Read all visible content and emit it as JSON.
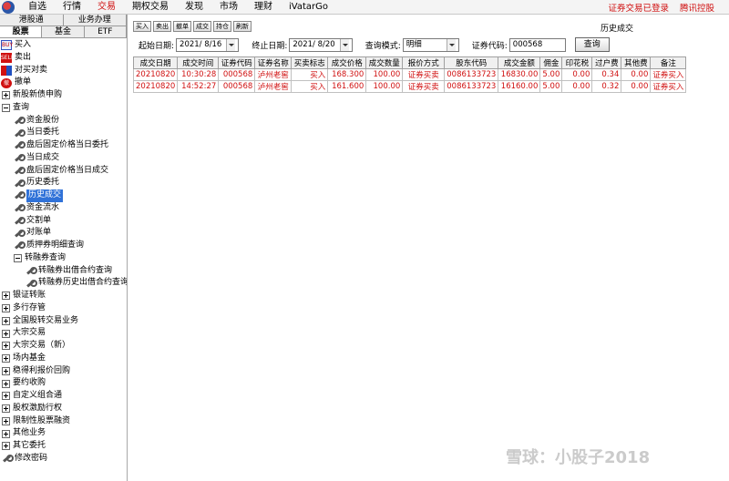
{
  "topbar": {
    "menu": [
      {
        "label": "自选"
      },
      {
        "label": "行情"
      },
      {
        "label": "交易",
        "active": true
      },
      {
        "label": "期权交易"
      },
      {
        "label": "发现"
      },
      {
        "label": "市场"
      },
      {
        "label": "理财"
      },
      {
        "label": "iVatarGo"
      }
    ],
    "status_login": "证券交易已登录",
    "tencent_tag": "腾讯控股"
  },
  "left_tabs": {
    "row1": [
      "港股通",
      "业务办理"
    ],
    "row2": [
      "股票",
      "基金",
      "ETF"
    ]
  },
  "tree": [
    {
      "label": "买入",
      "icon": "buy-icon",
      "level": 0
    },
    {
      "label": "卖出",
      "icon": "sell-icon",
      "level": 0
    },
    {
      "label": "对买对卖",
      "icon": "buy-sell-icon",
      "level": 0
    },
    {
      "label": "撤单",
      "icon": "cancel-order-icon",
      "level": 0
    },
    {
      "label": "新股新债申购",
      "icon": "expand-icon",
      "level": 0,
      "expander": "plus"
    },
    {
      "label": "查询",
      "icon": "collapse-icon",
      "level": 0,
      "expander": "minus"
    },
    {
      "label": "资金股份",
      "icon": "wrench-icon",
      "level": 1
    },
    {
      "label": "当日委托",
      "icon": "wrench-icon",
      "level": 1
    },
    {
      "label": "盘后固定价格当日委托",
      "icon": "wrench-icon",
      "level": 1
    },
    {
      "label": "当日成交",
      "icon": "wrench-icon",
      "level": 1
    },
    {
      "label": "盘后固定价格当日成交",
      "icon": "wrench-icon",
      "level": 1
    },
    {
      "label": "历史委托",
      "icon": "wrench-icon",
      "level": 1
    },
    {
      "label": "历史成交",
      "icon": "wrench-icon",
      "level": 1,
      "selected": true
    },
    {
      "label": "资金流水",
      "icon": "wrench-icon",
      "level": 1
    },
    {
      "label": "交割单",
      "icon": "wrench-icon",
      "level": 1
    },
    {
      "label": "对账单",
      "icon": "wrench-icon",
      "level": 1
    },
    {
      "label": "质押券明细查询",
      "icon": "wrench-icon",
      "level": 1
    },
    {
      "label": "转融券查询",
      "icon": "collapse-icon",
      "level": 1,
      "expander": "minus"
    },
    {
      "label": "转融券出借合约查询",
      "icon": "wrench-icon",
      "level": 2
    },
    {
      "label": "转融券历史出借合约查询",
      "icon": "wrench-icon",
      "level": 2
    },
    {
      "label": "银证转账",
      "icon": "expand-icon",
      "level": 0,
      "expander": "plus"
    },
    {
      "label": "多行存管",
      "icon": "expand-icon",
      "level": 0,
      "expander": "plus"
    },
    {
      "label": "全国股转交易业务",
      "icon": "expand-icon",
      "level": 0,
      "expander": "plus"
    },
    {
      "label": "大宗交易",
      "icon": "expand-icon",
      "level": 0,
      "expander": "plus"
    },
    {
      "label": "大宗交易（新）",
      "icon": "expand-icon",
      "level": 0,
      "expander": "plus"
    },
    {
      "label": "场内基金",
      "icon": "expand-icon",
      "level": 0,
      "expander": "plus"
    },
    {
      "label": "稳得利报价回购",
      "icon": "expand-icon",
      "level": 0,
      "expander": "plus"
    },
    {
      "label": "要约收购",
      "icon": "expand-icon",
      "level": 0,
      "expander": "plus"
    },
    {
      "label": "自定义组合通",
      "icon": "expand-icon",
      "level": 0,
      "expander": "plus"
    },
    {
      "label": "股权激励行权",
      "icon": "expand-icon",
      "level": 0,
      "expander": "plus"
    },
    {
      "label": "限制性股票融资",
      "icon": "expand-icon",
      "level": 0,
      "expander": "plus"
    },
    {
      "label": "其他业务",
      "icon": "expand-icon",
      "level": 0,
      "expander": "plus"
    },
    {
      "label": "其它委托",
      "icon": "expand-icon",
      "level": 0,
      "expander": "plus"
    },
    {
      "label": "修改密码",
      "icon": "wrench-icon",
      "level": 0
    }
  ],
  "toolbar": {
    "buttons": [
      "买入",
      "卖出",
      "撤单",
      "成交",
      "持仓",
      "刷新"
    ],
    "page_title": "历史成交"
  },
  "filter": {
    "start_label": "起始日期:",
    "start_value": "2021/ 8/16",
    "end_label": "终止日期:",
    "end_value": "2021/ 8/20",
    "mode_label": "查询模式:",
    "mode_value": "明细",
    "code_label": "证券代码:",
    "code_value": "000568",
    "query_button": "查询"
  },
  "grid": {
    "columns": [
      "成交日期",
      "成交时间",
      "证券代码",
      "证券名称",
      "买卖标志",
      "成交价格",
      "成交数量",
      "报价方式",
      "股东代码",
      "成交金额",
      "佣金",
      "印花税",
      "过户费",
      "其他费",
      "备注"
    ],
    "rows": [
      [
        "20210820",
        "10:30:28",
        "000568",
        "泸州老窖",
        "买入",
        "168.300",
        "100.00",
        "证券买卖",
        "0086133723",
        "16830.00",
        "5.00",
        "0.00",
        "0.34",
        "0.00",
        "证券买入"
      ],
      [
        "20210820",
        "14:52:27",
        "000568",
        "泸州老窖",
        "买入",
        "161.600",
        "100.00",
        "证券买卖",
        "0086133723",
        "16160.00",
        "5.00",
        "0.00",
        "0.32",
        "0.00",
        "证券买入"
      ]
    ]
  },
  "watermark": "雪球：小股子2018"
}
